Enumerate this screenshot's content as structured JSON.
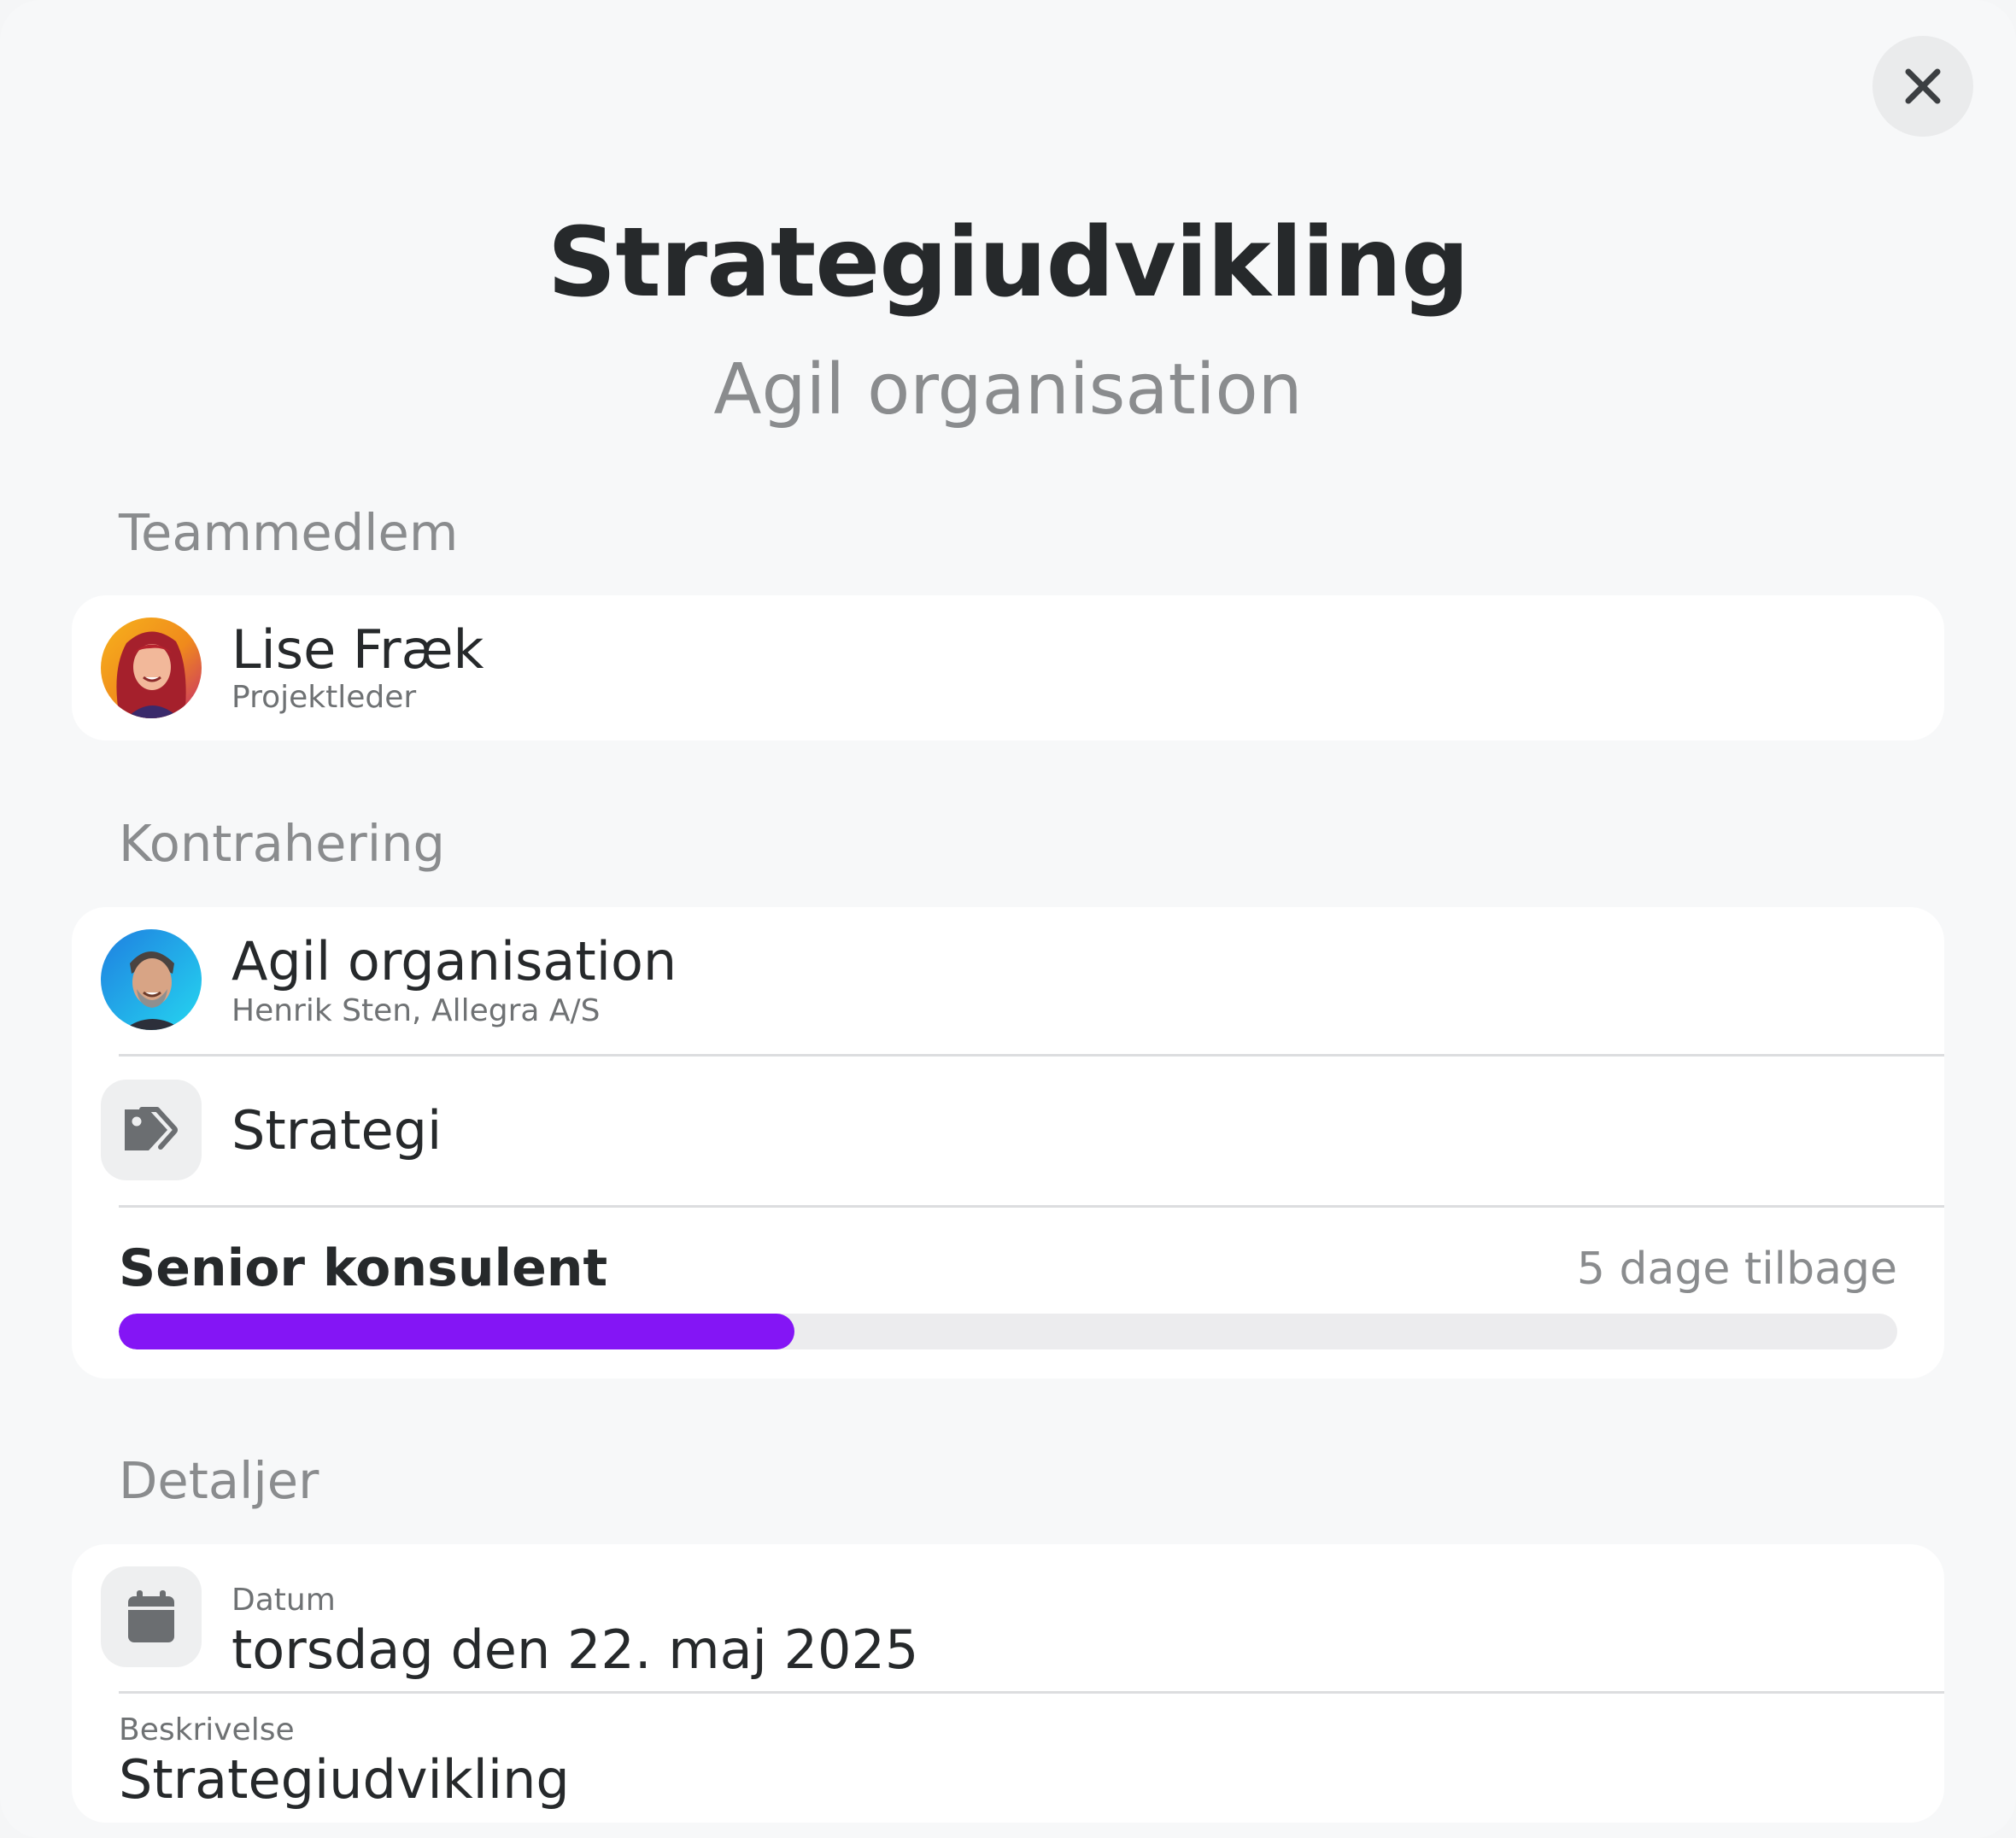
{
  "header": {
    "title": "Strategiudvikling",
    "subtitle": "Agil organisation",
    "close_icon": "close-icon"
  },
  "team": {
    "section_label": "Teammedlem",
    "member": {
      "name": "Lise Fræk",
      "role": "Projektleder"
    }
  },
  "contract": {
    "section_label": "Kontrahering",
    "client": {
      "name": "Agil organisation",
      "contact": "Henrik Sten, Allegra A/S"
    },
    "category": {
      "icon": "tag-icon",
      "label": "Strategi"
    },
    "role": {
      "title": "Senior konsulent",
      "time_ago": "5 dage tilbage",
      "progress_percent": 38,
      "progress_color": "#8415f5"
    }
  },
  "details": {
    "section_label": "Detaljer",
    "date": {
      "icon": "calendar-icon",
      "label": "Datum",
      "value": "torsdag den 22. maj 2025"
    },
    "description": {
      "label": "Beskrivelse",
      "value": "Strategiudvikling"
    }
  }
}
